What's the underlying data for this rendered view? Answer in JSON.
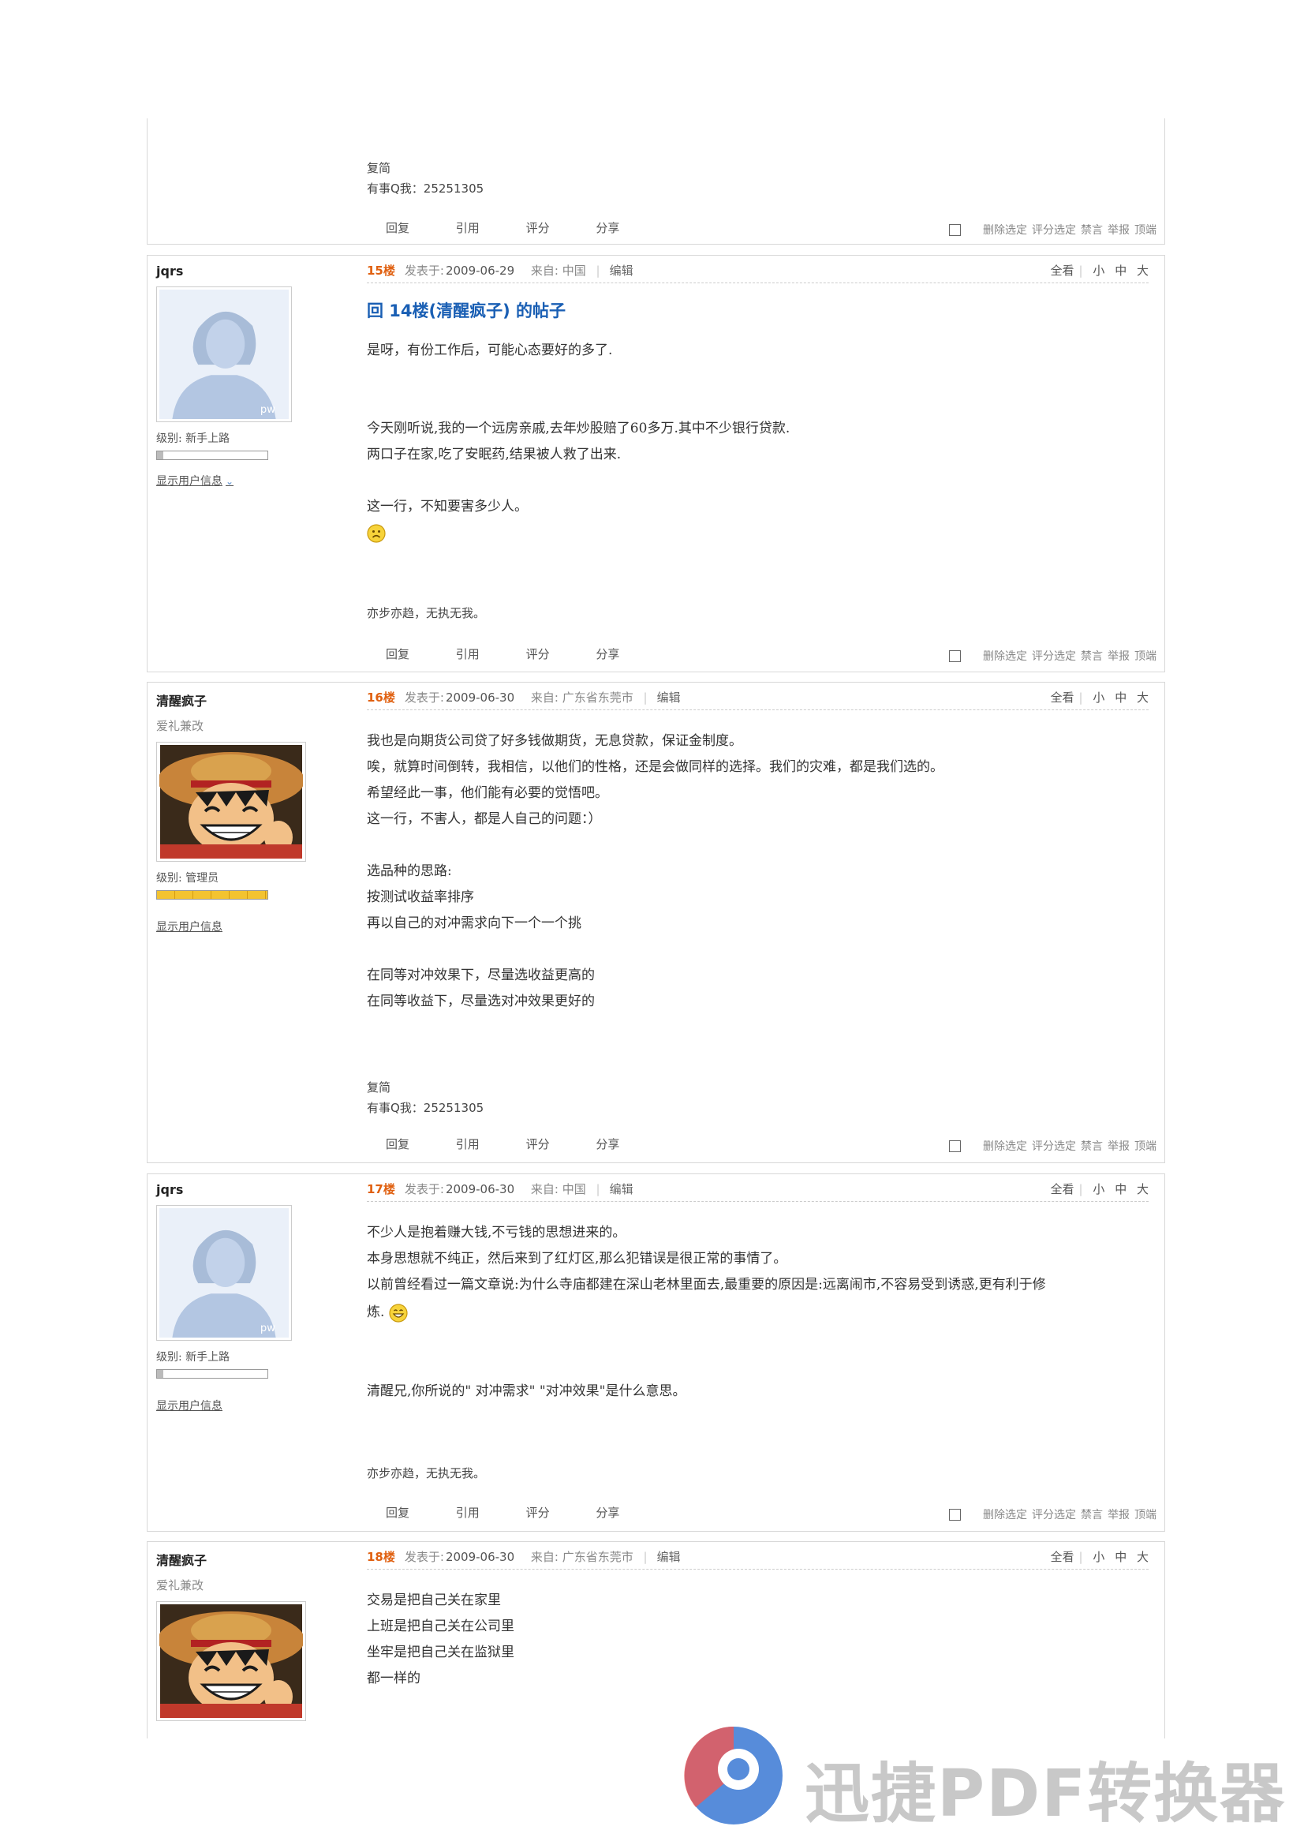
{
  "common": {
    "actions": [
      "回复",
      "引用",
      "评分",
      "分享"
    ],
    "tools": [
      "删除选定",
      "评分选定",
      "禁言",
      "举报",
      "顶端"
    ],
    "view_labels": [
      "全看",
      "小",
      "中",
      "大"
    ],
    "posted_label": "发表于:",
    "from_label": "来自:",
    "edit_label": "编辑",
    "level_label": "级别:",
    "show_info_label": "显示用户信息"
  },
  "top_partial": {
    "sig_name": "复简",
    "sig_qq": "有事Q我：25251305"
  },
  "posts": [
    {
      "user": "jqrs",
      "level": "新手上路",
      "floor": "15楼",
      "date": "2009-06-29",
      "from": "中国",
      "title": "回 14楼(清醒疯子) 的帖子",
      "lines": [
        "是呀，有份工作后，可能心态要好的多了.",
        "",
        "",
        "今天刚听说,我的一个远房亲戚,去年炒股赔了60多万.其中不少银行贷款.",
        "两口子在家,吃了安眠药,结果被人救了出来.",
        "",
        "这一行，不知要害多少人。"
      ],
      "signature": "亦步亦趋，无执无我。"
    },
    {
      "user": "清醒疯子",
      "user_title": "爱礼兼改",
      "level": "管理员",
      "floor": "16楼",
      "date": "2009-06-30",
      "from": "广东省东莞市",
      "lines": [
        "我也是向期货公司贷了好多钱做期货，无息贷款，保证金制度。",
        "唉，就算时间倒转，我相信，以他们的性格，还是会做同样的选择。我们的灾难，都是我们选的。",
        "希望经此一事，他们能有必要的觉悟吧。",
        "这一行，不害人，都是人自己的问题：）",
        "",
        "选品种的思路:",
        "按测试收益率排序",
        "再以自己的对冲需求向下一个一个挑",
        "",
        "在同等对冲效果下，尽量选收益更高的",
        "在同等收益下，尽量选对冲效果更好的"
      ],
      "sig_name": "复简",
      "sig_qq": "有事Q我：25251305"
    },
    {
      "user": "jqrs",
      "level": "新手上路",
      "floor": "17楼",
      "date": "2009-06-30",
      "from": "中国",
      "lines": [
        "不少人是抱着赚大钱,不亏钱的思想进来的。",
        "本身思想就不纯正，然后来到了红灯区,那么犯错误是很正常的事情了。",
        "以前曾经看过一篇文章说:为什么寺庙都建在深山老林里面去,最重要的原因是:远离闹市,不容易受到诱惑,更有利于修",
        "炼.",
        "",
        "",
        "清醒兄,你所说的\" 对冲需求\" \"对冲效果\"是什么意思。"
      ],
      "signature": "亦步亦趋，无执无我。"
    },
    {
      "user": "清醒疯子",
      "user_title": "爱礼兼改",
      "floor": "18楼",
      "date": "2009-06-30",
      "from": "广东省东莞市",
      "lines": [
        "交易是把自己关在家里",
        "上班是把自己关在公司里",
        "坐牢是把自己关在监狱里",
        "都一样的"
      ]
    }
  ],
  "watermark": {
    "text": "迅捷PDF转换器",
    "brand_color": "#3a78d4",
    "accent_color": "#e85a5a"
  }
}
